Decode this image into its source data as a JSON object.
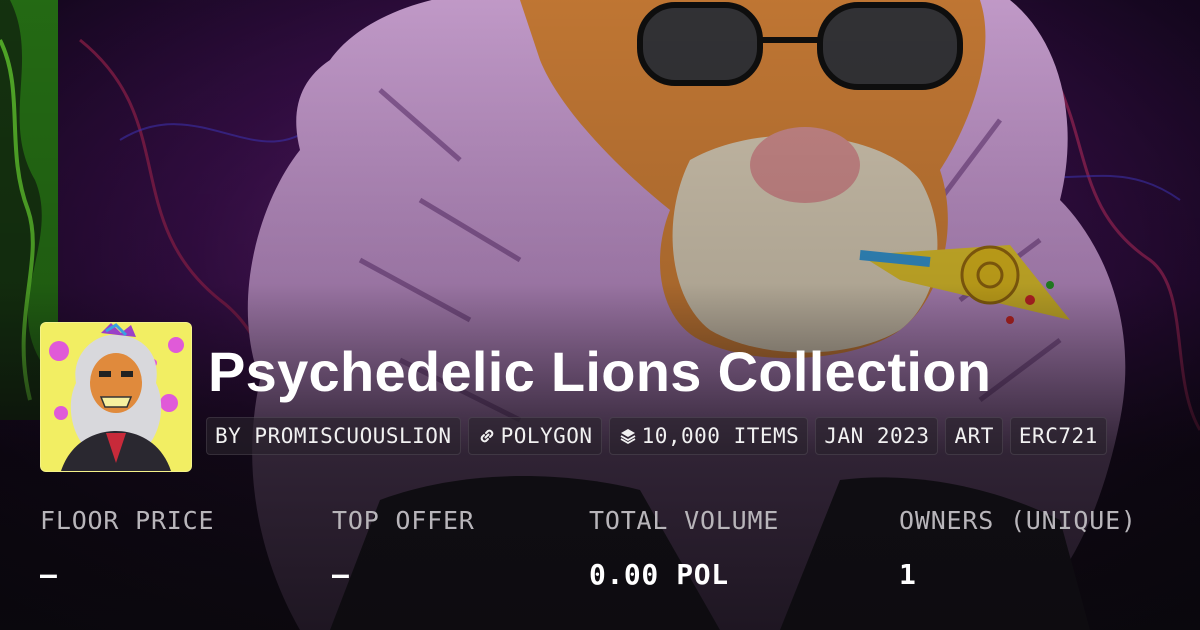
{
  "collection": {
    "title": "Psychedelic Lions Collection",
    "avatar_icon": "lion-avatar-icon",
    "background_icon": "lion-artwork-icon"
  },
  "tags": [
    {
      "label": "BY PROMISCUOUSLION",
      "icon": null
    },
    {
      "label": "POLYGON",
      "icon": "link-icon"
    },
    {
      "label": "10,000 ITEMS",
      "icon": "layers-icon"
    },
    {
      "label": "JAN 2023",
      "icon": null
    },
    {
      "label": "ART",
      "icon": null
    },
    {
      "label": "ERC721",
      "icon": null
    }
  ],
  "stats": [
    {
      "label": "FLOOR PRICE",
      "value": "–"
    },
    {
      "label": "TOP OFFER",
      "value": "–"
    },
    {
      "label": "TOTAL VOLUME",
      "value": "0.00 POL"
    },
    {
      "label": "OWNERS (UNIQUE)",
      "value": "1"
    }
  ],
  "colors": {
    "title": "#ffffff",
    "label": "#b8b5ba",
    "tag_bg": "#28222c",
    "avatar_bg": "#f2ee63",
    "mane_pink": "#c98bd6",
    "glasses": "#3a3a3e"
  }
}
